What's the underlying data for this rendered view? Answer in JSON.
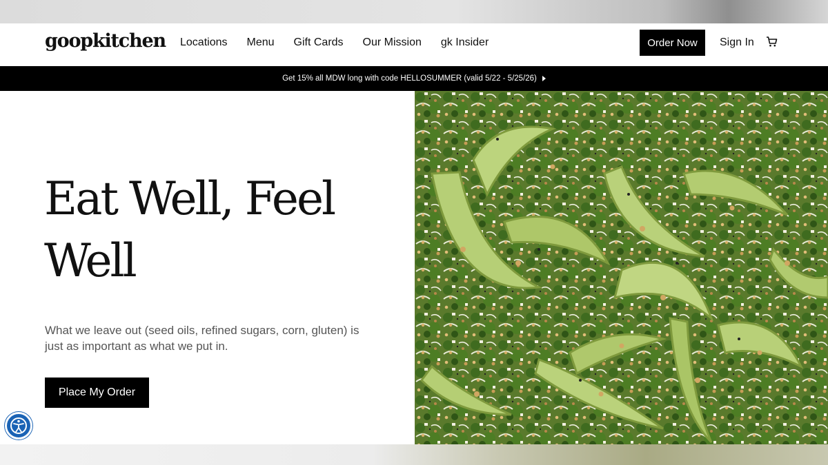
{
  "brand": {
    "logo_text": "goopkitchen"
  },
  "nav": {
    "items": [
      {
        "label": "Locations"
      },
      {
        "label": "Menu"
      },
      {
        "label": "Gift Cards"
      },
      {
        "label": "Our Mission"
      },
      {
        "label": "gk Insider"
      }
    ],
    "order_now_label": "Order Now",
    "sign_in_label": "Sign In",
    "cart_icon": "cart-icon"
  },
  "promo": {
    "text": "Get 15% all MDW long with code HELLOSUMMER (valid 5/22 - 5/25/26)",
    "arrow_icon": "play-arrow-icon"
  },
  "hero": {
    "headline": "Eat Well, Feel Well",
    "subtext": "What we leave out (seed oils, refined sugars, corn, gluten) is just as important as what we put in.",
    "cta_label": "Place My Order",
    "image_subject": "salad with avocado slices, kale and grains"
  },
  "accessibility": {
    "icon": "accessibility-icon"
  },
  "colors": {
    "primary_black": "#000000",
    "background": "#ffffff",
    "accessibility_blue": "#1a63b5",
    "avocado_green": "#a9c266",
    "kale_green": "#3f6b1f"
  }
}
